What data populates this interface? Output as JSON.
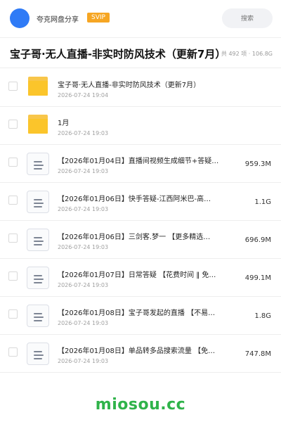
{
  "header": {
    "brand": "夸克网盘分享",
    "badge": "SVIP",
    "search_placeholder": "搜索"
  },
  "share": {
    "title": "宝子哥·无人直播-非实时防风技术（更新7月）",
    "meta": "共 492 项 · 106.8G"
  },
  "items": [
    {
      "type": "folder",
      "name": "宝子哥·无人直播-非实时防风技术（更新7月）",
      "date": "2026-07-24 19:04",
      "size": ""
    },
    {
      "type": "folder",
      "name": "1月",
      "date": "2026-07-24 19:03",
      "size": ""
    },
    {
      "type": "file",
      "name": "【2026年01月04日】直播间视频生成细节+答疑…",
      "date": "2026-07-24 19:03",
      "size": "959.3M"
    },
    {
      "type": "file",
      "name": "【2026年01月06日】快手答疑-江西阿米巴-高…",
      "date": "2026-07-24 19:03",
      "size": "1.1G"
    },
    {
      "type": "file",
      "name": "【2026年01月06日】三剑客.梦一 【更多精选…",
      "date": "2026-07-24 19:03",
      "size": "696.9M"
    },
    {
      "type": "file",
      "name": "【2026年01月07日】日常答疑 【花费时间 ‖ 免…",
      "date": "2026-07-24 19:03",
      "size": "499.1M"
    },
    {
      "type": "file",
      "name": "【2026年01月08日】宝子哥发起的直播 【不易…",
      "date": "2026-07-24 19:03",
      "size": "1.8G"
    },
    {
      "type": "file",
      "name": "【2026年01月08日】单品转多品搜索流量 【免…",
      "date": "2026-07-24 19:03",
      "size": "747.8M"
    }
  ],
  "watermark": "miosou.cc",
  "colors": {
    "avatar": "#2f7bf6",
    "badge": "#f6a623",
    "folder": "#fbc52b",
    "watermark": "#2fb34a"
  }
}
